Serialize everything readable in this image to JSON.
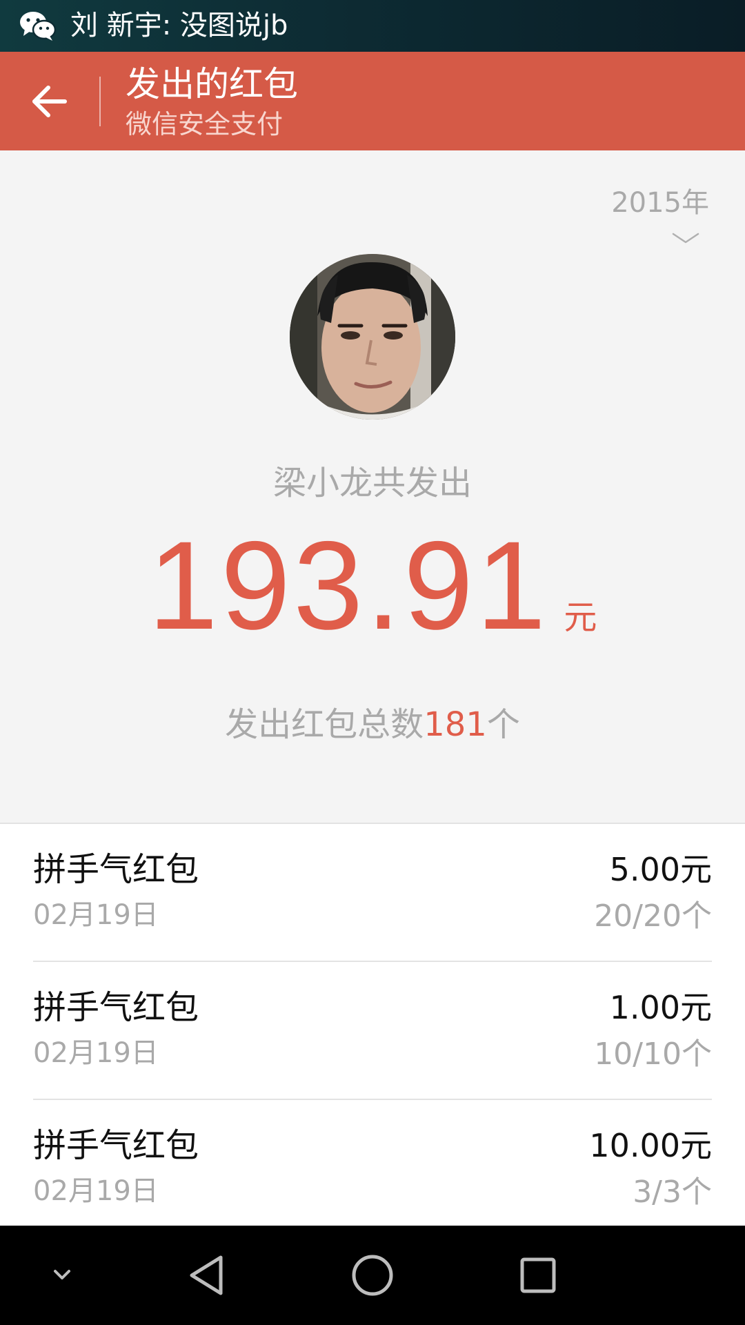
{
  "status_bar": {
    "notification": "刘 新宇: 没图说jb",
    "icon": "wechat-icon"
  },
  "header": {
    "back_icon": "back-arrow-icon",
    "title": "发出的红包",
    "subtitle": "微信安全支付",
    "color": "#d55a47"
  },
  "summary": {
    "year": "2015年",
    "year_icon": "chevron-down-icon",
    "sender_label": "梁小龙共发出",
    "amount": "193.91",
    "amount_unit": "元",
    "count_prefix": "发出红包总数",
    "count_value": "181",
    "count_suffix": "个",
    "accent_color": "#e05d4a"
  },
  "list": {
    "items": [
      {
        "title": "拼手气红包",
        "date": "02月19日",
        "amount": "5.00元",
        "count": "20/20个"
      },
      {
        "title": "拼手气红包",
        "date": "02月19日",
        "amount": "1.00元",
        "count": "10/10个"
      },
      {
        "title": "拼手气红包",
        "date": "02月19日",
        "amount": "10.00元",
        "count": "3/3个"
      }
    ]
  },
  "nav_bar": {
    "buttons": [
      "hide-keyboard-icon",
      "back-triangle-icon",
      "home-circle-icon",
      "recents-square-icon"
    ]
  }
}
